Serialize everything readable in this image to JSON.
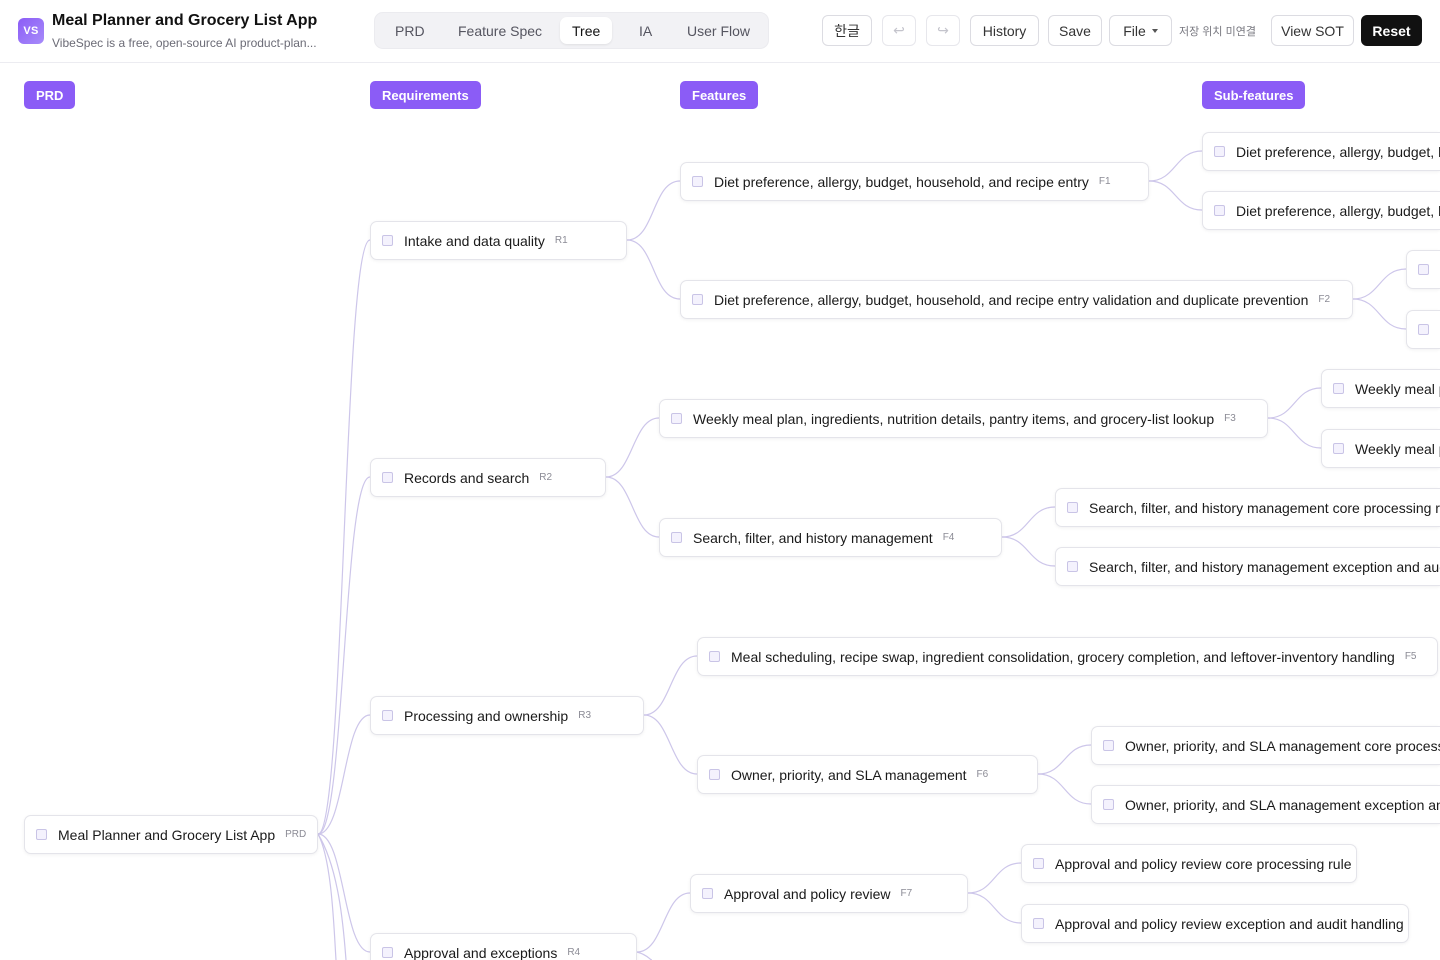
{
  "header": {
    "logo_text": "VS",
    "title": "Meal Planner and Grocery List App",
    "subtitle": "VibeSpec is a free, open-source AI product-plan...",
    "tabs": [
      "PRD",
      "Feature Spec",
      "Tree",
      "IA",
      "User Flow"
    ],
    "active_tab": "Tree",
    "lang_button": "한글",
    "undo_symbol": "↩",
    "redo_symbol": "↪",
    "history_label": "History",
    "save_label": "Save",
    "file_label": "File",
    "save_location_text": "저장 위치 미연결",
    "view_sot_label": "View SOT",
    "reset_label": "Reset"
  },
  "columns": {
    "prd": "PRD",
    "requirements": "Requirements",
    "features": "Features",
    "subfeatures": "Sub-features"
  },
  "tree": {
    "root": {
      "label": "Meal Planner and Grocery List App",
      "code": "PRD"
    },
    "requirements": [
      {
        "label": "Intake and data quality",
        "code": "R1"
      },
      {
        "label": "Records and search",
        "code": "R2"
      },
      {
        "label": "Processing and ownership",
        "code": "R3"
      },
      {
        "label": "Approval and exceptions",
        "code": "R4"
      }
    ],
    "features": [
      {
        "label": "Diet preference, allergy, budget, household, and recipe entry",
        "code": "F1"
      },
      {
        "label": "Diet preference, allergy, budget, household, and recipe entry validation and duplicate prevention",
        "code": "F2"
      },
      {
        "label": "Weekly meal plan, ingredients, nutrition details, pantry items, and grocery-list lookup",
        "code": "F3"
      },
      {
        "label": "Search, filter, and history management",
        "code": "F4"
      },
      {
        "label": "Meal scheduling, recipe swap, ingredient consolidation, grocery completion, and leftover-inventory handling",
        "code": "F5"
      },
      {
        "label": "Owner, priority, and SLA management",
        "code": "F6"
      },
      {
        "label": "Approval and policy review",
        "code": "F7"
      }
    ],
    "subfeatures": [
      {
        "label": "Diet preference, allergy, budget, hou"
      },
      {
        "label": "Diet preference, allergy, budget, hou"
      },
      {
        "label": ""
      },
      {
        "label": ""
      },
      {
        "label": "Weekly meal pl"
      },
      {
        "label": "Weekly meal pl"
      },
      {
        "label": "Search, filter, and history management core processing rule"
      },
      {
        "label": "Search, filter, and history management exception and audit ha"
      },
      {
        "label": "Owner, priority, and SLA management core processing r"
      },
      {
        "label": "Owner, priority, and SLA management exception and au"
      },
      {
        "label": "Approval and policy review core processing rule"
      },
      {
        "label": "Approval and policy review exception and audit handling"
      }
    ]
  },
  "colors": {
    "accent": "#8b5cf6",
    "edge": "#cdc6ea",
    "dark_button": "#111111"
  }
}
